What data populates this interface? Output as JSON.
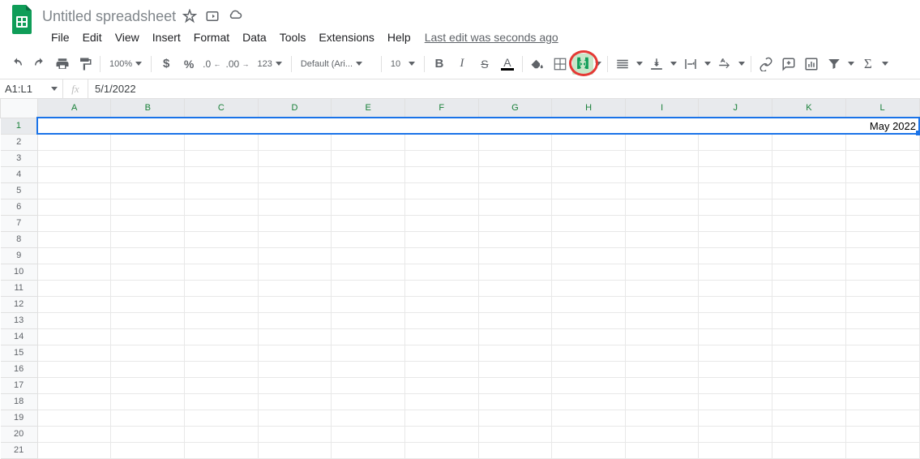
{
  "doc": {
    "title": "Untitled spreadsheet"
  },
  "menubar": {
    "items": [
      "File",
      "Edit",
      "View",
      "Insert",
      "Format",
      "Data",
      "Tools",
      "Extensions",
      "Help"
    ],
    "last_edit": "Last edit was seconds ago"
  },
  "toolbar": {
    "zoom": "100%",
    "font": "Default (Ari...",
    "font_size": "10"
  },
  "namebox": {
    "ref": "A1:L1"
  },
  "formula": {
    "value": "5/1/2022"
  },
  "columns": [
    "A",
    "B",
    "C",
    "D",
    "E",
    "F",
    "G",
    "H",
    "I",
    "J",
    "K",
    "L"
  ],
  "rows": [
    "1",
    "2",
    "3",
    "4",
    "5",
    "6",
    "7",
    "8",
    "9",
    "10",
    "11",
    "12",
    "13",
    "14",
    "15",
    "16",
    "17",
    "18",
    "19",
    "20",
    "21"
  ],
  "cells": {
    "merged_A1_L1": "May 2022"
  }
}
